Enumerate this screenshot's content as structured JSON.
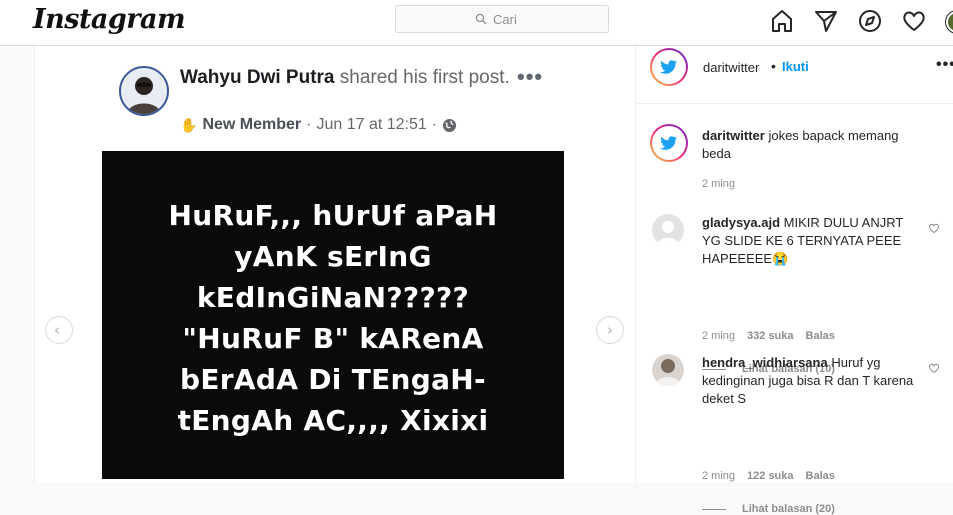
{
  "header": {
    "logo": "Instagram",
    "search_placeholder": "Cari",
    "icons": [
      "home-icon",
      "direct-icon",
      "explore-icon",
      "heart-icon",
      "profile-avatar"
    ]
  },
  "post_image": {
    "author_name": "Wahyu Dwi Putra",
    "action_text": " shared his first post.",
    "member_label": "New Member",
    "date": "Jun 17 at 12:51",
    "meme_lines": [
      "HuRuF,,, hUrUf aPaH",
      "yAnK sErInG",
      "kEdInGiNaN?????",
      "\"HuRuF B\" kARenA",
      "bErAdA Di TEngaH-",
      "tEngAh AC,,,, Xixixi"
    ]
  },
  "panel": {
    "username": "daritwitter",
    "separator": "•",
    "follow_label": "Ikuti",
    "caption": {
      "username": "daritwitter",
      "text": " jokes bapack memang beda",
      "time": "2 ming"
    },
    "comments": [
      {
        "username": "gladysya.ajd",
        "text": " MIKIR DULU ANJRT YG SLIDE KE 6 TERNYATA PEEE HAPEEEEE😭",
        "time": "2 ming",
        "likes": "332 suka",
        "reply_label": "Balas",
        "view_replies": "Lihat balasan (10)"
      },
      {
        "username": "hendra_widhiarsana",
        "text": " Huruf yg kedinginan juga bisa R dan T karena deket S",
        "time": "2 ming",
        "likes": "122 suka",
        "reply_label": "Balas",
        "view_replies": "Lihat balasan (20)"
      }
    ]
  },
  "colors": {
    "link_blue": "#0095f6",
    "border": "#dbdbdb",
    "meta_gray": "#8e8e8e",
    "twitter_blue": "#1da1f2"
  }
}
